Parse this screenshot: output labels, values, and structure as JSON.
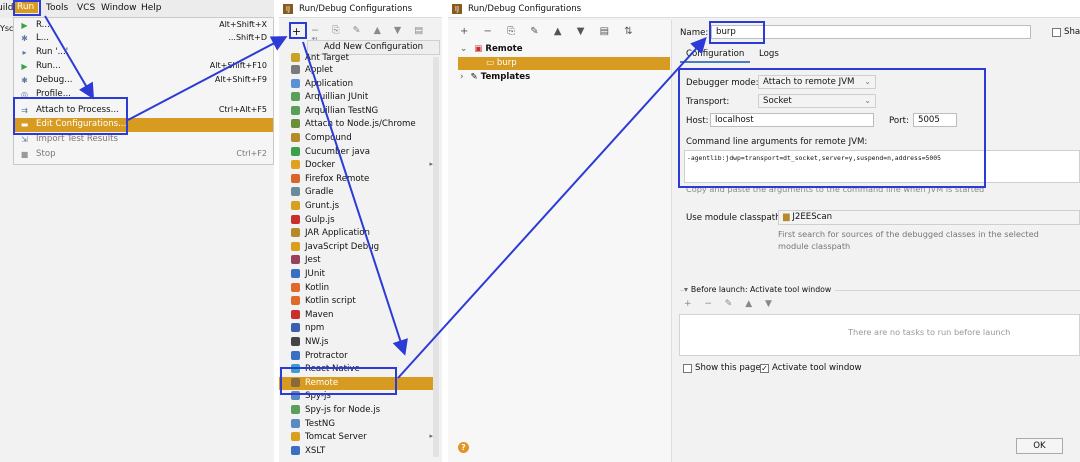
{
  "run_menu": {
    "menubar": [
      "uild",
      "Run",
      "Tools",
      "VCS",
      "Window",
      "Help"
    ],
    "side_text": "Ysc",
    "items": [
      {
        "label": "R...",
        "shortcut": "Alt+Shift+X",
        "icon": "run-icon"
      },
      {
        "label": "L...",
        "shortcut": "...Shift+D",
        "icon": "debug-icon"
      },
      {
        "label": "Run '...'",
        "shortcut": "",
        "icon": "run-config-icon"
      },
      {
        "label": "Run...",
        "shortcut": "Alt+Shift+F10",
        "icon": "run-icon"
      },
      {
        "label": "Debug...",
        "shortcut": "Alt+Shift+F9",
        "icon": "debug-icon"
      },
      {
        "label": "Profile...",
        "shortcut": "",
        "icon": "profile-icon"
      },
      {
        "label": "Attach to Process...",
        "shortcut": "Ctrl+Alt+F5",
        "icon": "attach-icon"
      },
      {
        "label": "Edit Configurations...",
        "shortcut": "",
        "icon": "edit-config-icon"
      },
      {
        "label": "Import Test Results",
        "shortcut": "",
        "icon": "import-icon"
      },
      {
        "label": "Stop",
        "shortcut": "Ctrl+F2",
        "icon": "stop-icon"
      }
    ]
  },
  "add_config_panel": {
    "title": "Run/Debug Configurations",
    "plus": "+",
    "popup_title": "Add New Configuration",
    "items": [
      {
        "label": "Ant Target",
        "color": "#c9a227"
      },
      {
        "label": "Applet",
        "color": "#7a7a7a"
      },
      {
        "label": "Application",
        "color": "#5b8fd6"
      },
      {
        "label": "Arquillian JUnit",
        "color": "#5a9e5a"
      },
      {
        "label": "Arquillian TestNG",
        "color": "#5a9e5a"
      },
      {
        "label": "Attach to Node.js/Chrome",
        "color": "#6a8e3a"
      },
      {
        "label": "Compound",
        "color": "#b58a2a"
      },
      {
        "label": "Cucumber java",
        "color": "#3aa04a"
      },
      {
        "label": "Docker",
        "color": "#e0a020",
        "arrow": "▸"
      },
      {
        "label": "Firefox Remote",
        "color": "#d9652b"
      },
      {
        "label": "Gradle",
        "color": "#6b8a9a"
      },
      {
        "label": "Grunt.js",
        "color": "#d9a020"
      },
      {
        "label": "Gulp.js",
        "color": "#c9302c"
      },
      {
        "label": "JAR Application",
        "color": "#b58a2a"
      },
      {
        "label": "JavaScript Debug",
        "color": "#d9a020"
      },
      {
        "label": "Jest",
        "color": "#99425b"
      },
      {
        "label": "JUnit",
        "color": "#3a6fc4"
      },
      {
        "label": "Kotlin",
        "color": "#e06a2b"
      },
      {
        "label": "Kotlin script",
        "color": "#e06a2b"
      },
      {
        "label": "Maven",
        "color": "#c9302c"
      },
      {
        "label": "npm",
        "color": "#3a5fb0"
      },
      {
        "label": "NW.js",
        "color": "#444444"
      },
      {
        "label": "Protractor",
        "color": "#3a6fc4"
      },
      {
        "label": "React Native",
        "color": "#3aa0c9"
      },
      {
        "label": "Remote",
        "color": "#8a6a3a"
      },
      {
        "label": "Spy-js",
        "color": "#5a8ac4"
      },
      {
        "label": "Spy-js for Node.js",
        "color": "#5a9e5a"
      },
      {
        "label": "TestNG",
        "color": "#5a8ac4"
      },
      {
        "label": "Tomcat Server",
        "color": "#d9a020",
        "arrow": "▸"
      },
      {
        "label": "XSLT",
        "color": "#3a6fc4"
      }
    ]
  },
  "config_panel": {
    "title": "Run/Debug Configurations",
    "toolbar": "+ − ⎘ ✎ ▲ ▼ ▤ ⇅",
    "tree": {
      "remote": "Remote",
      "burp": "burp",
      "templates": "Templates"
    },
    "name_label": "Name:",
    "name_value": "burp",
    "share_label": "Shar",
    "tab_config": "Configuration",
    "tab_logs": "Logs",
    "debugger_mode_label": "Debugger mode:",
    "debugger_mode_value": "Attach to remote JVM",
    "transport_label": "Transport:",
    "transport_value": "Socket",
    "host_label": "Host:",
    "host_value": "localhost",
    "port_label": "Port:",
    "port_value": "5005",
    "cmd_label": "Command line arguments for remote JVM:",
    "cmd_value": "-agentlib:jdwp=transport=dt_socket,server=y,suspend=n,address=5005",
    "cmd_hint": "Copy and paste the arguments to the command line when JVM is started",
    "classpath_label": "Use module classpath:",
    "classpath_value": "J2EEScan",
    "classpath_note": "First search for sources of the debugged classes in the selected module classpath",
    "before_launch": "Before launch: Activate tool window",
    "bl_tools": "+ − ✎ ▲ ▼",
    "bl_empty": "There are no tasks to run before launch",
    "show_page": "Show this page",
    "activate_tool": "Activate tool window",
    "ok": "OK"
  },
  "colors": {
    "accent": "#d89b22",
    "highlight": "#2c3ad6"
  }
}
